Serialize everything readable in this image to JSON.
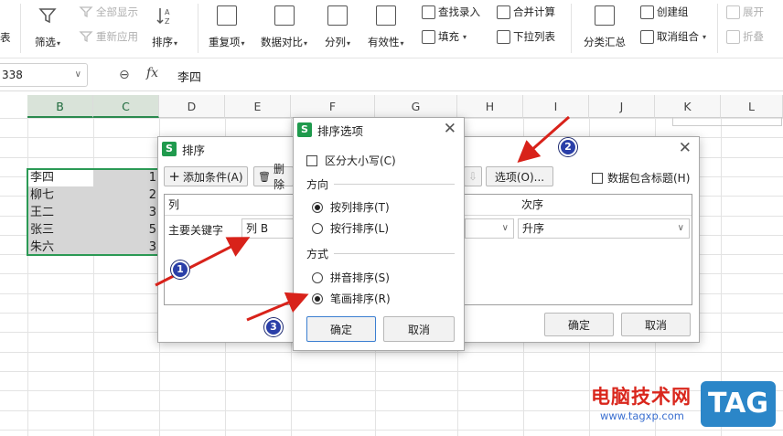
{
  "ribbon": {
    "partial_left": "表",
    "filter": "筛选",
    "show_all": "全部显示",
    "reapply": "重新应用",
    "sort": "排序",
    "duplicates": "重复项",
    "compare": "数据对比",
    "split": "分列",
    "validity": "有效性",
    "lookup_entry": "查找录入",
    "fill": "填充",
    "merge_calc": "合并计算",
    "dropdown_list": "下拉列表",
    "subtotal": "分类汇总",
    "create_group": "创建组",
    "ungroup": "取消组合",
    "expand": "展开",
    "collapse": "折叠"
  },
  "formula_bar": {
    "name_box": "338",
    "fx_symbol": "fx",
    "value": "李四"
  },
  "columns": [
    "B",
    "C",
    "D",
    "E",
    "F",
    "G",
    "H",
    "I",
    "J",
    "K",
    "L"
  ],
  "rows": [
    {
      "name": "李四",
      "num": "1"
    },
    {
      "name": "柳七",
      "num": "2"
    },
    {
      "name": "王二",
      "num": "3"
    },
    {
      "name": "张三",
      "num": "5"
    },
    {
      "name": "朱六",
      "num": "3"
    }
  ],
  "sort_dialog": {
    "title": "排序",
    "add_condition": "添加条件(A)",
    "delete_condition": "删除",
    "options": "选项(O)...",
    "header_checkbox": "数据包含标题(H)",
    "col_header": "列",
    "order_header": "次序",
    "primary_key_label": "主要关键字",
    "primary_key_value": "列 B",
    "order_value": "升序",
    "ok": "确定",
    "cancel": "取消"
  },
  "options_dialog": {
    "title": "排序选项",
    "case_sensitive": "区分大小写(C)",
    "direction_label": "方向",
    "by_column": "按列排序(T)",
    "by_row": "按行排序(L)",
    "method_label": "方式",
    "pinyin": "拼音排序(S)",
    "stroke": "笔画排序(R)",
    "ok": "确定",
    "cancel": "取消"
  },
  "annotations": [
    "1",
    "2",
    "3"
  ],
  "watermark": {
    "site_cn": "电脑技术网",
    "url": "www.tagxp.com",
    "tag": "TAG"
  },
  "colors": {
    "accent_green": "#2b9a55",
    "arrow_red": "#d8221a",
    "badge_blue": "#2a3fa8",
    "watermark_red": "#d9261c",
    "tag_blue": "#2b86c8"
  }
}
